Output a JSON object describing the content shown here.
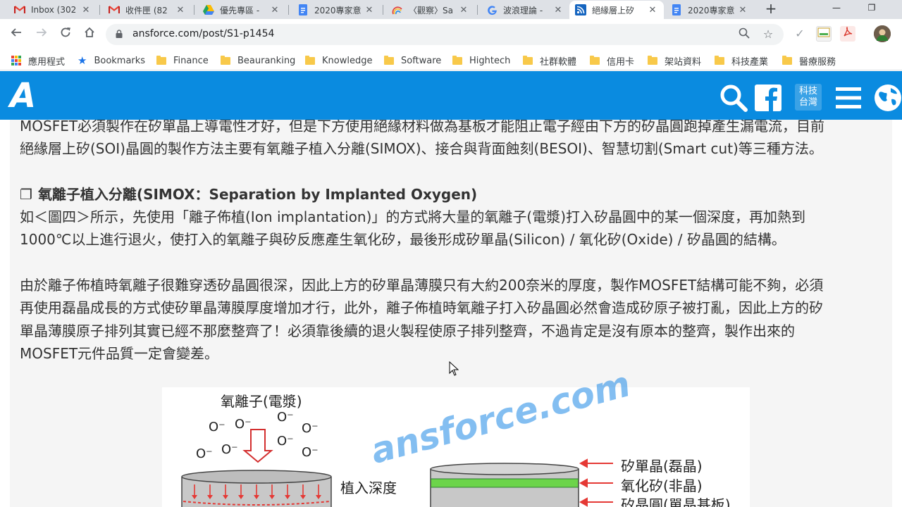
{
  "browser": {
    "tabs": [
      {
        "title": "Inbox (302",
        "icon": "gmail-icon"
      },
      {
        "title": "收件匣 (82",
        "icon": "gmail-icon"
      },
      {
        "title": "優先專區 -",
        "icon": "google-drive-icon"
      },
      {
        "title": "2020專家意",
        "icon": "google-docs-icon"
      },
      {
        "title": "〈觀察〉Sa",
        "icon": "rainbow-icon"
      },
      {
        "title": "波浪理論 -",
        "icon": "google-icon"
      },
      {
        "title": "絕緣層上矽",
        "icon": "rss-icon",
        "active": true
      },
      {
        "title": "2020專家意",
        "icon": "google-docs-icon"
      }
    ],
    "url": "ansforce.com/post/S1-p1454",
    "bookmarks": [
      {
        "label": "應用程式",
        "type": "apps"
      },
      {
        "label": "Bookmarks",
        "type": "star"
      },
      {
        "label": "Finance",
        "type": "folder"
      },
      {
        "label": "Beauranking",
        "type": "folder"
      },
      {
        "label": "Knowledge",
        "type": "folder"
      },
      {
        "label": "Software",
        "type": "folder"
      },
      {
        "label": "Hightech",
        "type": "folder"
      },
      {
        "label": "社群軟體",
        "type": "folder"
      },
      {
        "label": "信用卡",
        "type": "folder"
      },
      {
        "label": "架站資料",
        "type": "folder"
      },
      {
        "label": "科技產業",
        "type": "folder"
      },
      {
        "label": "醫療服務",
        "type": "folder"
      }
    ]
  },
  "site": {
    "logo": "A",
    "tag_line1": "科技",
    "tag_line2": "台灣",
    "brand_color": "#0a8be0"
  },
  "article": {
    "intro_line1": "MOSFET必須製作在矽單晶上導電性才好，但是下方使用絕緣材料做為基板才能阻止電子經由下方的矽晶圓跑掉產生漏電流，目前",
    "intro_line2": "絕緣層上矽(SOI)晶圓的製作方法主要有氧離子植入分離(SIMOX)、接合與背面蝕刻(BESOI)、智慧切割(Smart cut)等三種方法。",
    "section_glyph": "❐",
    "section_title": "氧離子植入分離(SIMOX：Separation by Implanted Oxygen)",
    "p1_line1": "如＜圖四＞所示，先使用「離子佈植(Ion implantation)」的方式將大量的氧離子(電漿)打入矽晶圓中的某一個深度，再加熱到",
    "p1_line2": "1000℃以上進行退火，使打入的氧離子與矽反應產生氧化矽，最後形成矽單晶(Silicon) / 氧化矽(Oxide) / 矽晶圓的結構。",
    "p2_line1": "由於離子佈植時氧離子很難穿透矽晶圓很深，因此上方的矽單晶薄膜只有大約200奈米的厚度，製作MOSFET結構可能不夠，必須",
    "p2_line2": "再使用磊晶成長的方式使矽單晶薄膜厚度增加才行，此外，離子佈植時氧離子打入矽晶圓必然會造成矽原子被打亂，因此上方的矽",
    "p2_line3": "單晶薄膜原子排列其實已經不那麼整齊了！必須靠後續的退火製程使原子排列整齊，不過肯定是沒有原本的整齊，製作出來的",
    "p2_line4": "MOSFET元件品質一定會變差。"
  },
  "figure": {
    "plasma_label": "氧離子(電漿)",
    "ion_label": "O⁻",
    "depth_label": "植入深度",
    "label_silicon": "矽單晶(磊晶)",
    "label_oxide": "氧化矽(非晶)",
    "label_wafer": "矽晶圓(單晶基板)",
    "watermark": "ansforce.com"
  }
}
